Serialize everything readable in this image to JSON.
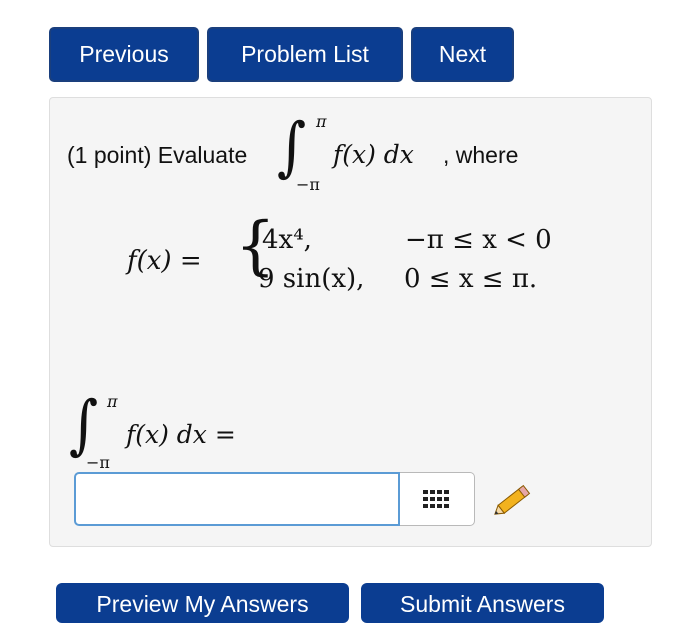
{
  "nav": {
    "previous_label": "Previous",
    "problem_list_label": "Problem List",
    "next_label": "Next"
  },
  "problem": {
    "prefix": "(1 point) Evaluate",
    "integral_upper": "π",
    "integral_lower": "−π",
    "integrand": "f(x) dx",
    "suffix": ", where",
    "def_lhs": "f(x) =",
    "case1_expr": "4x⁴,",
    "case1_cond": "−π ≤ x < 0",
    "case2_expr": "9 sin(x),",
    "case2_cond": "0 ≤ x ≤ π."
  },
  "answer": {
    "integral_upper": "π",
    "integral_lower": "−π",
    "label": "f(x) dx =",
    "value": "",
    "placeholder": ""
  },
  "icons": {
    "keypad": "keypad-icon",
    "pencil": "pencil-icon"
  },
  "bottom": {
    "preview_label": "Preview My Answers",
    "submit_label": "Submit Answers"
  },
  "colors": {
    "button_bg": "#0b3d91",
    "input_border": "#5b9bd5",
    "panel_bg": "#f5f5f5"
  }
}
